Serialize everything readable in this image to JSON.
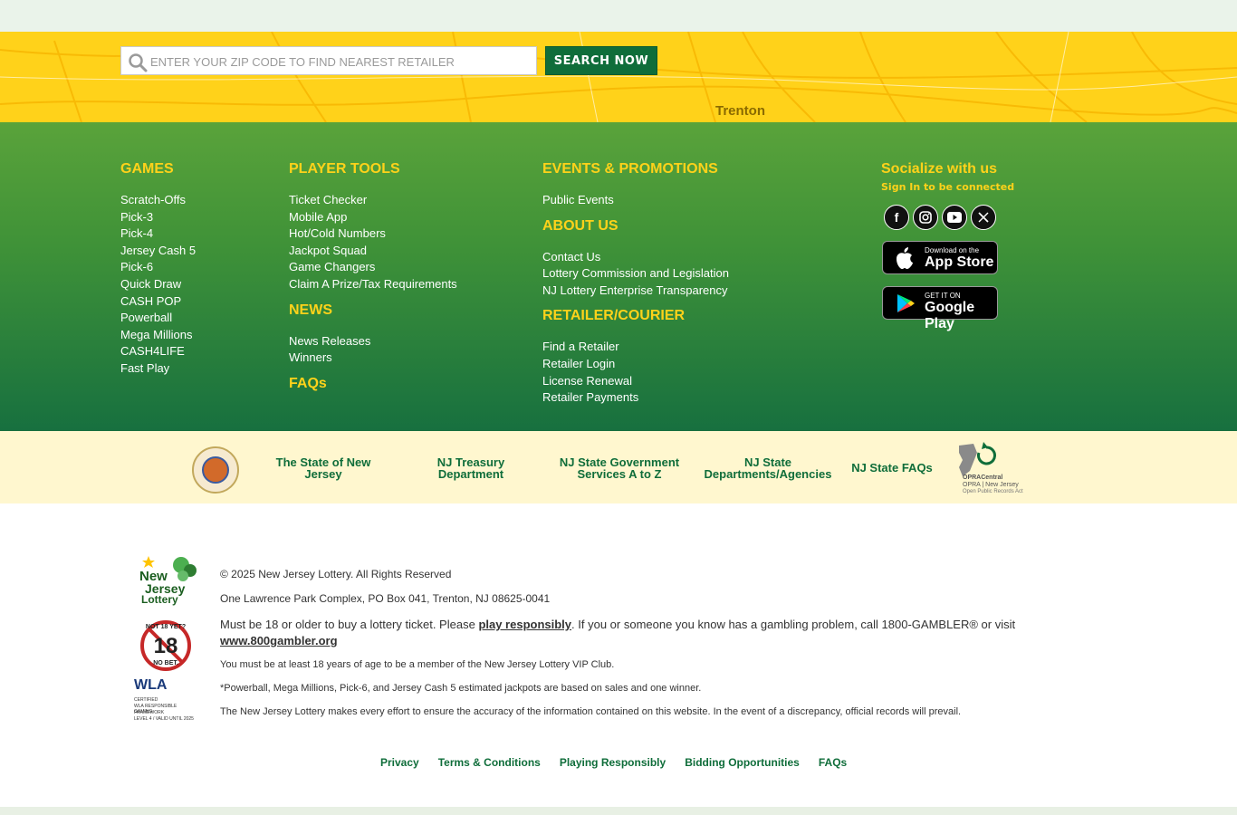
{
  "search": {
    "placeholder": "ENTER YOUR ZIP CODE TO FIND NEAREST RETAILER",
    "button_label": "SEARCH NOW",
    "map_label": "Trenton"
  },
  "nav": {
    "games": {
      "title": "GAMES",
      "items": [
        "Scratch-Offs",
        "Pick-3",
        "Pick-4",
        "Jersey Cash 5",
        "Pick-6",
        "Quick Draw",
        "CASH POP",
        "Powerball",
        "Mega Millions",
        "CASH4LIFE",
        "Fast Play"
      ]
    },
    "player_tools": {
      "title": "PLAYER TOOLS",
      "items": [
        "Ticket Checker",
        "Mobile App",
        "Hot/Cold Numbers",
        "Jackpot Squad",
        "Game Changers",
        "Claim A Prize/Tax Requirements"
      ]
    },
    "news": {
      "title": "NEWS",
      "items": [
        "News Releases",
        "Winners"
      ]
    },
    "faqs": {
      "title": "FAQs"
    },
    "events": {
      "title": "EVENTS & PROMOTIONS",
      "items": [
        "Public Events"
      ]
    },
    "about": {
      "title": "ABOUT US",
      "items": [
        "Contact Us",
        "Lottery Commission and Legislation",
        "NJ Lottery Enterprise Transparency"
      ]
    },
    "retailer": {
      "title": "RETAILER/COURIER",
      "items": [
        "Find a Retailer",
        "Retailer Login",
        "License Renewal",
        "Retailer Payments"
      ]
    }
  },
  "social": {
    "title": "Socialize with us",
    "signin": "Sign In to be connected",
    "icons": [
      "facebook-icon",
      "instagram-icon",
      "youtube-icon",
      "x-icon"
    ],
    "app_store": {
      "small": "Download on the",
      "big": "App Store"
    },
    "google_play": {
      "small": "GET IT ON",
      "big": "Google Play"
    }
  },
  "gov": {
    "seal_alt": "THE GREAT SEAL OF THE STATE OF NEW JERSEY",
    "links": [
      "The State of New Jersey",
      "NJ Treasury Department",
      "NJ State Government Services A to Z",
      "NJ State Departments/Agencies",
      "NJ State FAQs"
    ],
    "opra": {
      "line1": "OPRACentral",
      "line2": "OPRA | New Jersey",
      "line3": "Open Public Records Act"
    }
  },
  "footer": {
    "logos": {
      "lottery": [
        "New",
        "Jersey",
        "Lottery"
      ],
      "age": {
        "top": "NOT 18 YET?",
        "number": "18",
        "bottom": "NO BET."
      },
      "wla": {
        "name": "WLA",
        "line1": "CERTIFIED",
        "line2": "WLA RESPONSIBLE GAMING",
        "line3": "FRAMEWORK",
        "line4": "LEVEL 4 / VALID UNTIL 2025"
      }
    },
    "copyright": "© 2025 New Jersey Lottery. All Rights Reserved",
    "address": "One Lawrence Park Complex, PO Box 041, Trenton, NJ 08625-0041",
    "age_text_1": "Must be 18 or older to buy a lottery ticket. Please ",
    "play_responsibly": "play responsibly",
    "age_text_2": ". If you or someone you know has a gambling problem, call 1800-GAMBLER® or visit",
    "gambler_link": "www.800gambler.org",
    "vip": "You must be at least 18 years of age to be a member of the New Jersey Lottery VIP Club.",
    "jackpot_note": "*Powerball, Mega Millions, Pick-6, and Jersey Cash 5 estimated jackpots are based on sales and one winner.",
    "accuracy": "The New Jersey Lottery makes every effort to ensure the accuracy of the information contained on this website. In the event of a discrepancy, official records will prevail.",
    "bottom_links": [
      "Privacy",
      "Terms & Conditions",
      "Playing Responsibly",
      "Bidding Opportunities",
      "FAQs"
    ]
  }
}
